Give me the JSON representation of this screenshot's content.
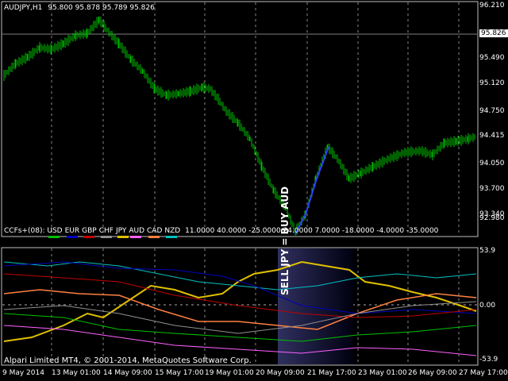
{
  "header": {
    "symbol_text": "AUDJPY,H1",
    "ohlc": "95.800 95.878 95.789 95.826"
  },
  "price_axis": [
    "96.210",
    "95.826",
    "95.490",
    "95.120",
    "94.750",
    "94.415",
    "94.050",
    "93.700",
    "93.340",
    "92.980"
  ],
  "current_price": "95.826",
  "indicator": {
    "legend_prefix": "CCFs+(08):",
    "currencies": [
      "USD",
      "EUR",
      "GBP",
      "CHF",
      "JPY",
      "AUD",
      "CAD",
      "NZD"
    ],
    "currency_colors": [
      "#00c000",
      "#0000c0",
      "#c00000",
      "#909090",
      "#e0c000",
      "#ff60ff",
      "#ff8040",
      "#00c0c0"
    ],
    "values_text": "11.0000 40.0000 -25.0000 24.0000 7.0000 -18.0000 -4.0000 -35.0000",
    "axis": [
      "53.9",
      "0.00",
      "-53.9"
    ]
  },
  "annotation": "SELL JPY = BUY AUD",
  "footer": "Alpari Limited MT4, © 2001-2014, MetaQuotes Software Corp.",
  "time_axis": [
    "9 May 2014",
    "13 May 01:00",
    "14 May 09:00",
    "15 May 17:00",
    "19 May 01:00",
    "20 May 09:00",
    "21 May 17:00",
    "23 May 01:00",
    "26 May 09:00",
    "27 May 17:00"
  ],
  "colors": {
    "bull": "#00c000",
    "signal": "#3040ff"
  }
}
